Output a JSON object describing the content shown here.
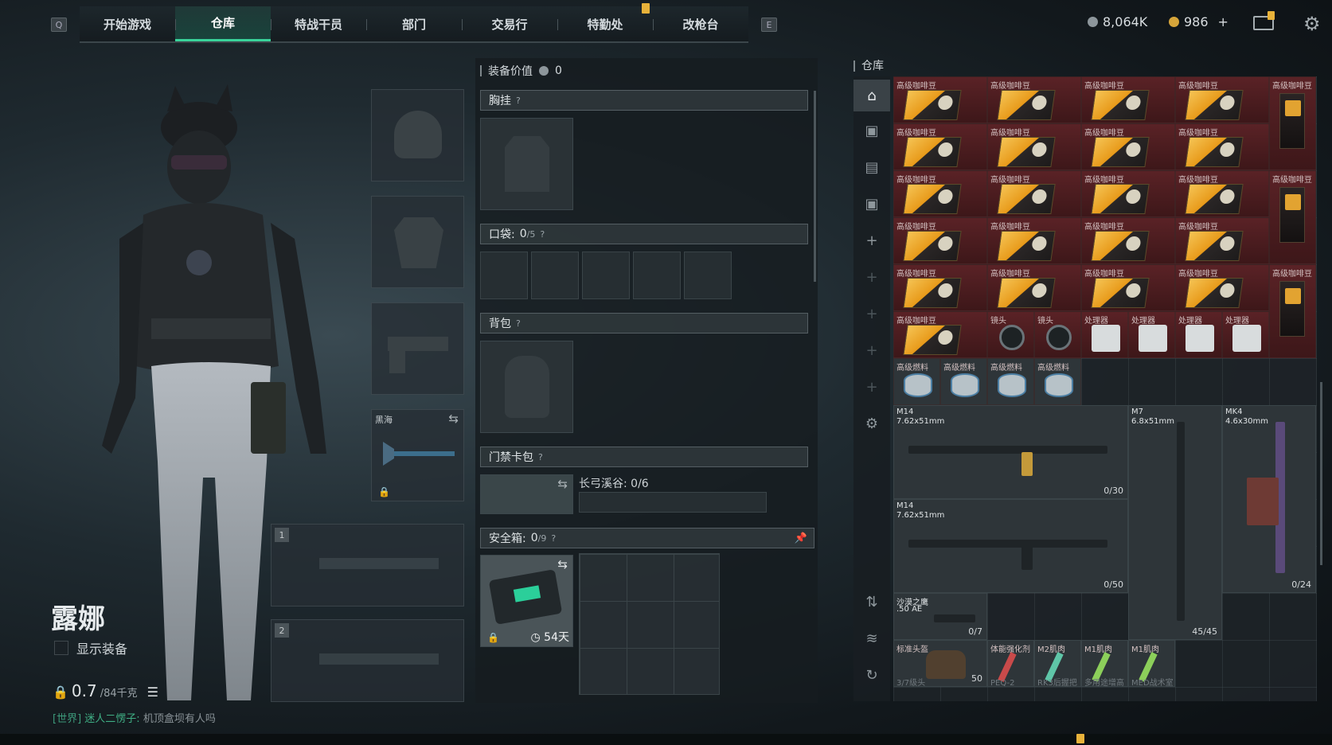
{
  "topbar": {
    "left_key": "Q",
    "right_key": "E",
    "tabs": [
      "开始游戏",
      "仓库",
      "特战干员",
      "部门",
      "交易行",
      "特勤处",
      "改枪台"
    ],
    "active_tab": "仓库",
    "currency_silver": "8,064K",
    "currency_gold": "986",
    "add_label": "+"
  },
  "character": {
    "name": "露娜",
    "show_equipment_label": "显示装备",
    "weight_value": "0.7",
    "weight_max": "/84千克"
  },
  "chat": {
    "channel": "[世界]",
    "sender": "迷人二愣子:",
    "message": "机顶盒坝有人吗"
  },
  "gear_slots": {
    "melee_label": "黑海",
    "weapon_slot_1": "1",
    "weapon_slot_2": "2"
  },
  "equipment": {
    "value_label": "装备价值",
    "value_amount": "0",
    "chest_rig_label": "胸挂",
    "pocket_label": "口袋:",
    "pocket_used": "0",
    "pocket_max": "/5",
    "backpack_label": "背包",
    "keycard_label": "门禁卡包",
    "keycard_map": "长弓溪谷: 0/6",
    "safebox_label": "安全箱:",
    "safebox_used": "0",
    "safebox_max": "/9",
    "safebox_timer": "54天",
    "qmark": "?"
  },
  "warehouse": {
    "title": "仓库",
    "coffee_label": "高级咖啡豆",
    "lens_label": "镜头",
    "cpu_label": "处理器",
    "fuel_label": "高级燃料",
    "guns": [
      {
        "name": "M14",
        "caliber": "7.62x51mm",
        "ammo": "0/30"
      },
      {
        "name": "M14",
        "caliber": "7.62x51mm",
        "ammo": "0/50"
      },
      {
        "name": "M7",
        "caliber": "6.8x51mm",
        "ammo": "45/45"
      },
      {
        "name": "MK4",
        "caliber": "4.6x30mm",
        "ammo": "0/24"
      },
      {
        "name": "沙漠之鹰",
        "caliber": ".50 AE",
        "ammo": "0/7"
      }
    ],
    "bottom_items": [
      {
        "label": "标准头盔",
        "sub": "3/7级头",
        "count": "50"
      },
      {
        "label": "体能强化剂",
        "sub": "PEQ-2"
      },
      {
        "label": "M2肌肉",
        "sub": "RK3后握把"
      },
      {
        "label": "M1肌肉",
        "sub": "多用途增高"
      },
      {
        "label": "M1肌肉",
        "sub": "MED战术室 全景红点"
      }
    ]
  },
  "colors": {
    "accent": "#39d39a",
    "item_red": "#5a2226",
    "notify": "#e8b23a"
  }
}
